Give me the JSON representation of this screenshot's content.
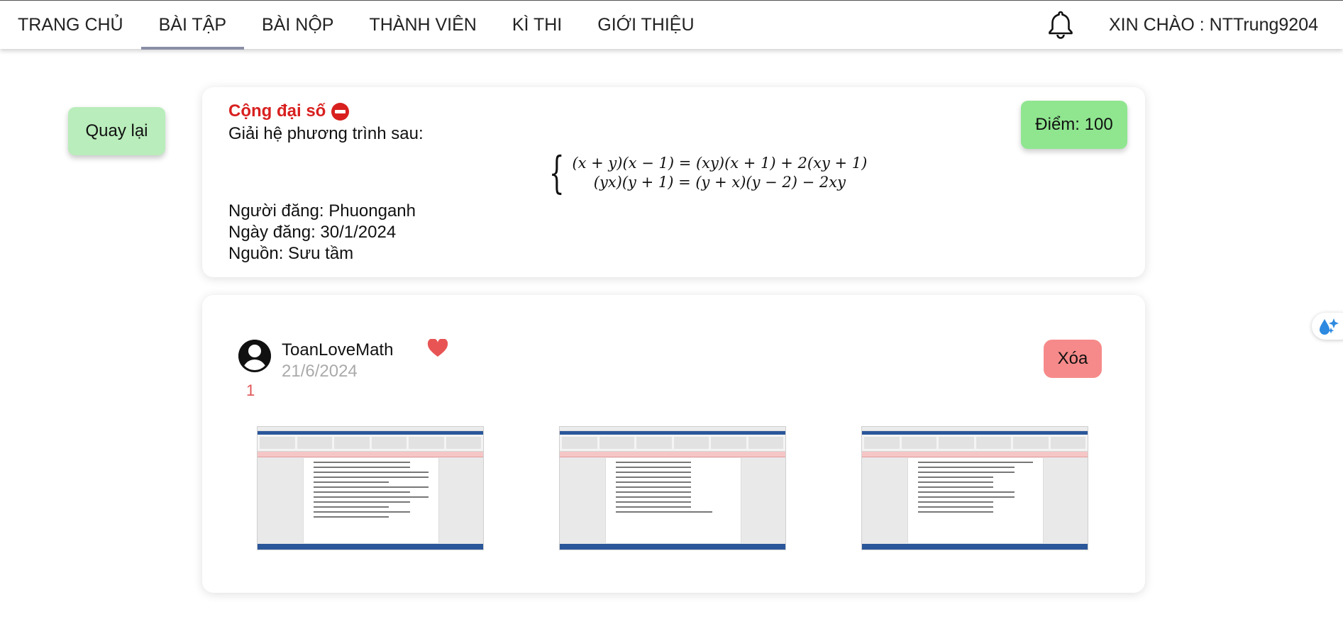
{
  "nav": {
    "items": [
      "TRANG CHỦ",
      "BÀI TẬP",
      "BÀI NỘP",
      "THÀNH VIÊN",
      "KÌ THI",
      "GIỚI THIỆU"
    ],
    "active_index": 1,
    "greeting": "XIN CHÀO : NTTrung9204",
    "bell_icon": "bell-icon"
  },
  "back_button": "Quay lại",
  "problem": {
    "title": "Cộng đại số",
    "title_icon": "minus-circle-icon",
    "description": "Giải hệ phương trình sau:",
    "equations": [
      "(x + y)(x − 1) = (xy)(x + 1) + 2(xy + 1)",
      "(yx)(y + 1) = (y + x)(y − 2) − 2xy"
    ],
    "posted_by": "Người đăng: Phuonganh",
    "posted_date": "Ngày đăng: 30/1/2024",
    "source": "Nguồn: Sưu tầm",
    "score": "Điểm: 100"
  },
  "submission": {
    "user": "ToanLoveMath",
    "date": "21/6/2024",
    "likes": "1",
    "like_icon": "heart-icon",
    "delete_label": "Xóa",
    "images": [
      "submission-image-1",
      "submission-image-2",
      "submission-image-3"
    ]
  },
  "colors": {
    "title_red": "#d8201f",
    "back_green": "#b9edbb",
    "score_green": "#8fe68f",
    "delete_red": "#f68a8a",
    "heart_red": "#e85454",
    "active_underline": "#8a8fa6"
  }
}
